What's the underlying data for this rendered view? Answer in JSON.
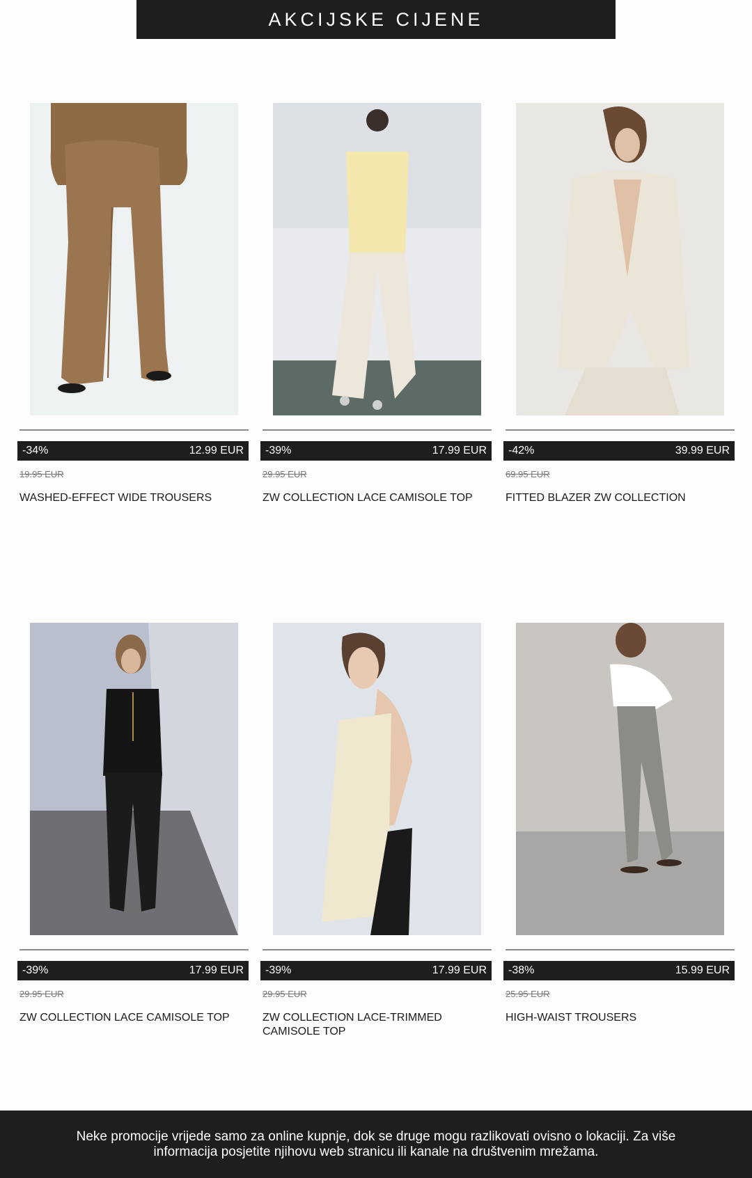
{
  "banner": {
    "title": "AKCIJSKE CIJENE"
  },
  "products": [
    {
      "discount": "-34%",
      "price": "12.99 EUR",
      "old_price": "19.95 EUR",
      "name": "WASHED-EFFECT WIDE TROUSERS"
    },
    {
      "discount": "-39%",
      "price": "17.99 EUR",
      "old_price": "29.95 EUR",
      "name": "ZW COLLECTION LACE CAMISOLE TOP"
    },
    {
      "discount": "-42%",
      "price": "39.99 EUR",
      "old_price": "69.95 EUR",
      "name": "FITTED BLAZER ZW COLLECTION"
    },
    {
      "discount": "-39%",
      "price": "17.99 EUR",
      "old_price": "29.95 EUR",
      "name": "ZW COLLECTION LACE CAMISOLE TOP"
    },
    {
      "discount": "-39%",
      "price": "17.99 EUR",
      "old_price": "29.95 EUR",
      "name": "ZW COLLECTION LACE-TRIMMED CAMISOLE TOP"
    },
    {
      "discount": "-38%",
      "price": "15.99 EUR",
      "old_price": "25.95 EUR",
      "name": "HIGH-WAIST TROUSERS"
    }
  ],
  "footer": {
    "text": "Neke promocije vrijede samo za online kupnje, dok se druge mogu razlikovati ovisno o lokaciji. Za više informacija posjetite njihovu web stranicu ili kanale na društvenim mrežama."
  },
  "colors": {
    "bar": "#1e1e1e",
    "rule": "#8c8c8c",
    "old_price": "#777777"
  }
}
